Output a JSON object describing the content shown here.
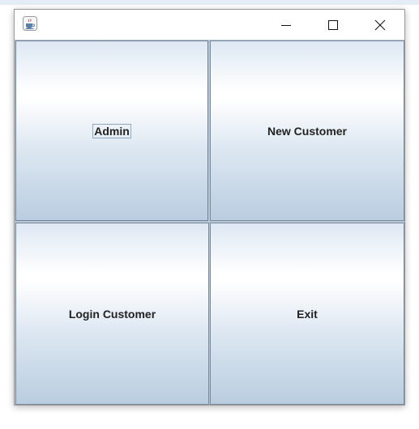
{
  "window": {
    "app_icon": "java-coffee-cup-icon",
    "controls": {
      "minimize": "minimize-icon",
      "maximize": "maximize-icon",
      "close": "close-icon"
    }
  },
  "buttons": {
    "admin": "Admin",
    "new_customer": "New Customer",
    "login_customer": "Login Customer",
    "exit": "Exit"
  },
  "colors": {
    "button_gradient_top": "#dde8f3",
    "button_gradient_mid": "#ffffff",
    "button_gradient_bottom": "#b9cde0",
    "label_text": "#222222"
  }
}
